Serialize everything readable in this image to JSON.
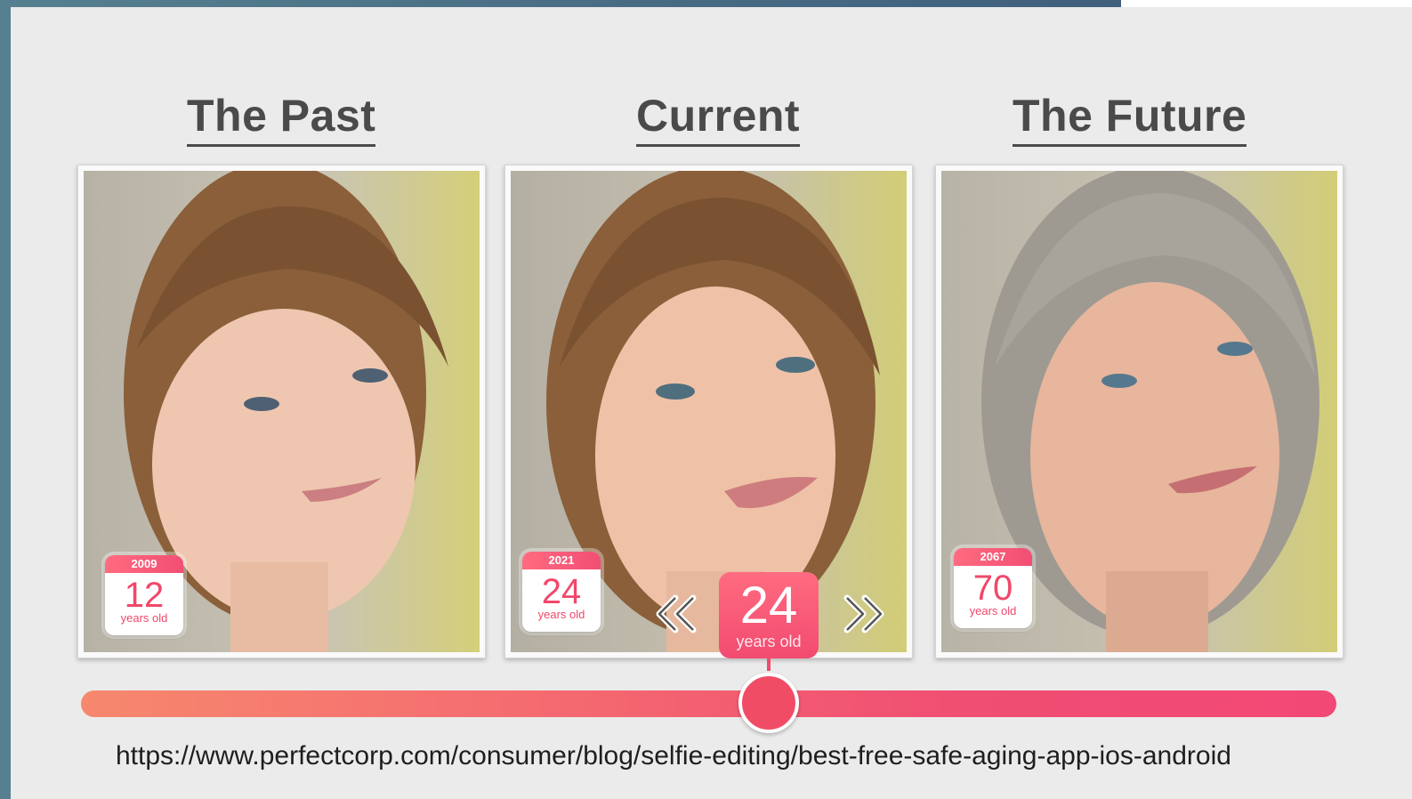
{
  "headings": {
    "past": "The Past",
    "current": "Current",
    "future": "The Future"
  },
  "cards": [
    {
      "year": "2009",
      "age": "12",
      "age_label": "years old"
    },
    {
      "year": "2021",
      "age": "24",
      "age_label": "years old"
    },
    {
      "year": "2067",
      "age": "70",
      "age_label": "years old"
    }
  ],
  "slider": {
    "value": "24",
    "unit_label": "years old",
    "position_fraction": 0.52
  },
  "source_url": "https://www.perfectcorp.com/consumer/blog/selfie-editing/best-free-safe-aging-app-ios-android",
  "colors": {
    "accent": "#f24b70",
    "slider_start": "#f6886e",
    "slider_end": "#f24876",
    "heading": "#4a4a4a"
  },
  "icons": {
    "prev": "double-chevron-left-icon",
    "next": "double-chevron-right-icon"
  }
}
